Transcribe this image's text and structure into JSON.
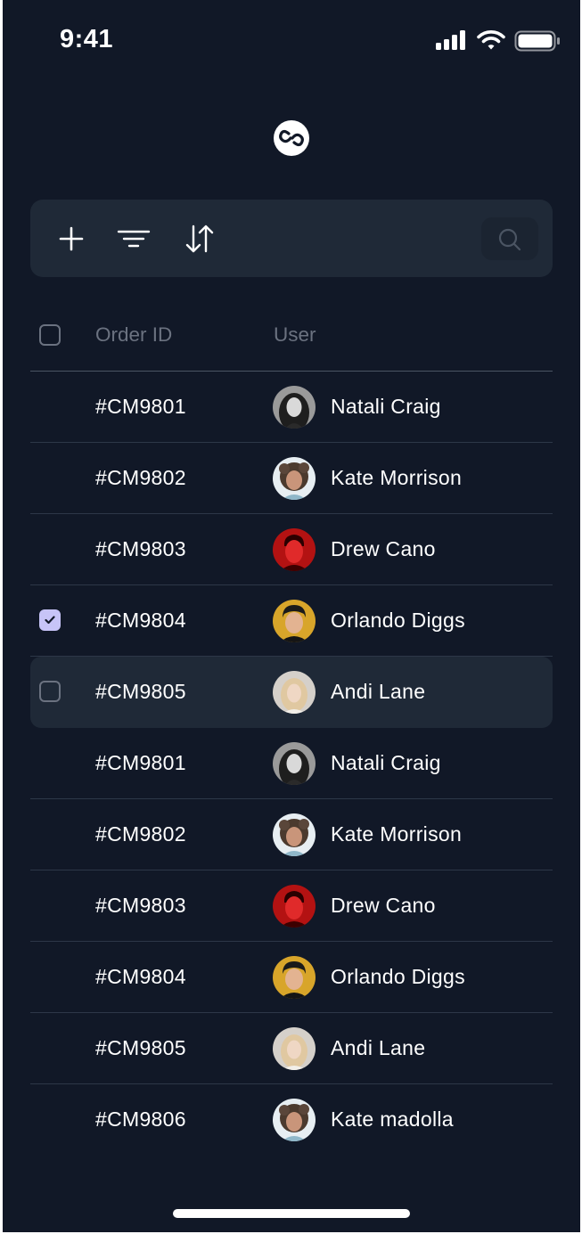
{
  "status_bar": {
    "time": "9:41"
  },
  "table": {
    "headers": {
      "order_id": "Order ID",
      "user": "User"
    },
    "rows": [
      {
        "order_id": "#CM9801",
        "user": "Natali Craig",
        "avatar": "avatar-natali",
        "checkbox": "none"
      },
      {
        "order_id": "#CM9802",
        "user": "Kate Morrison",
        "avatar": "avatar-kate",
        "checkbox": "none"
      },
      {
        "order_id": "#CM9803",
        "user": "Drew Cano",
        "avatar": "avatar-drew",
        "checkbox": "none"
      },
      {
        "order_id": "#CM9804",
        "user": "Orlando Diggs",
        "avatar": "avatar-orlando",
        "checkbox": "checked"
      },
      {
        "order_id": "#CM9805",
        "user": "Andi Lane",
        "avatar": "avatar-andi",
        "checkbox": "unchecked",
        "highlighted": true
      },
      {
        "order_id": "#CM9801",
        "user": "Natali Craig",
        "avatar": "avatar-natali",
        "checkbox": "none"
      },
      {
        "order_id": "#CM9802",
        "user": "Kate Morrison",
        "avatar": "avatar-kate",
        "checkbox": "none"
      },
      {
        "order_id": "#CM9803",
        "user": "Drew Cano",
        "avatar": "avatar-drew",
        "checkbox": "none"
      },
      {
        "order_id": "#CM9804",
        "user": "Orlando Diggs",
        "avatar": "avatar-orlando",
        "checkbox": "none"
      },
      {
        "order_id": "#CM9805",
        "user": "Andi Lane",
        "avatar": "avatar-andi",
        "checkbox": "none"
      },
      {
        "order_id": "#CM9806",
        "user": "Kate madolla",
        "avatar": "avatar-kate",
        "checkbox": "none"
      }
    ]
  },
  "toolbar": {
    "icons": [
      "plus-icon",
      "filter-icon",
      "sort-icon",
      "search-icon"
    ]
  },
  "colors": {
    "background": "#111827",
    "toolbar": "#1f2937",
    "highlight_row": "#1f2937",
    "checkbox_checked": "#c7c4f7",
    "text_primary": "#ffffff",
    "text_muted": "#6b7280"
  }
}
